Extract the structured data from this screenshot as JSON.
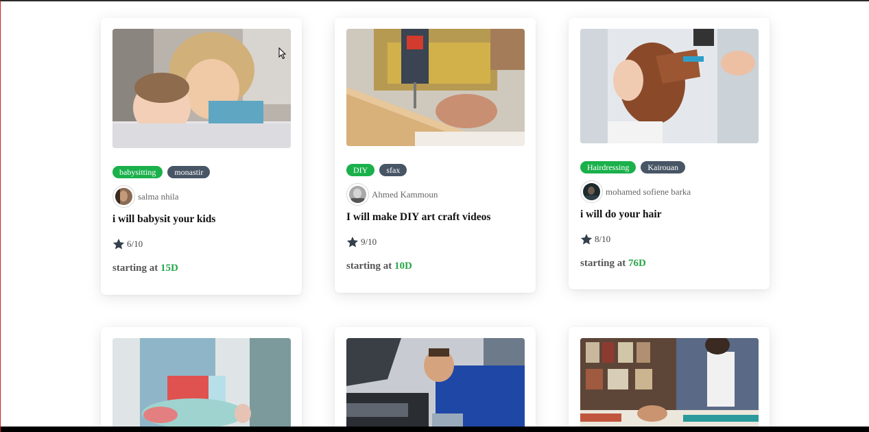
{
  "gigs": [
    {
      "image": "children-photo",
      "category": "babysitting",
      "location": "monastir",
      "author": "salma nhila",
      "title": "i will babysit your kids",
      "rating": "6/10",
      "price_prefix": "starting at",
      "price": "15D"
    },
    {
      "image": "drill-woodwork-photo",
      "category": "DIY",
      "location": "sfax",
      "author": "Ahmed Kammoun",
      "title": "I will make DIY art craft videos",
      "rating": "9/10",
      "price_prefix": "starting at",
      "price": "10D"
    },
    {
      "image": "hairdressing-photo",
      "category": "Hairdressing",
      "location": "Kairouan",
      "author": "mohamed sofiene barka",
      "title": "i will do your hair",
      "rating": "8/10",
      "price_prefix": "starting at",
      "price": "76D"
    },
    {
      "image": "cleaning-supplies-photo"
    },
    {
      "image": "mechanic-photo"
    },
    {
      "image": "studying-student-photo"
    }
  ],
  "colors": {
    "category_tag": "#1ab04b",
    "location_tag": "#475565",
    "price": "#28a74b"
  },
  "icons": {
    "rating": "star-icon"
  }
}
